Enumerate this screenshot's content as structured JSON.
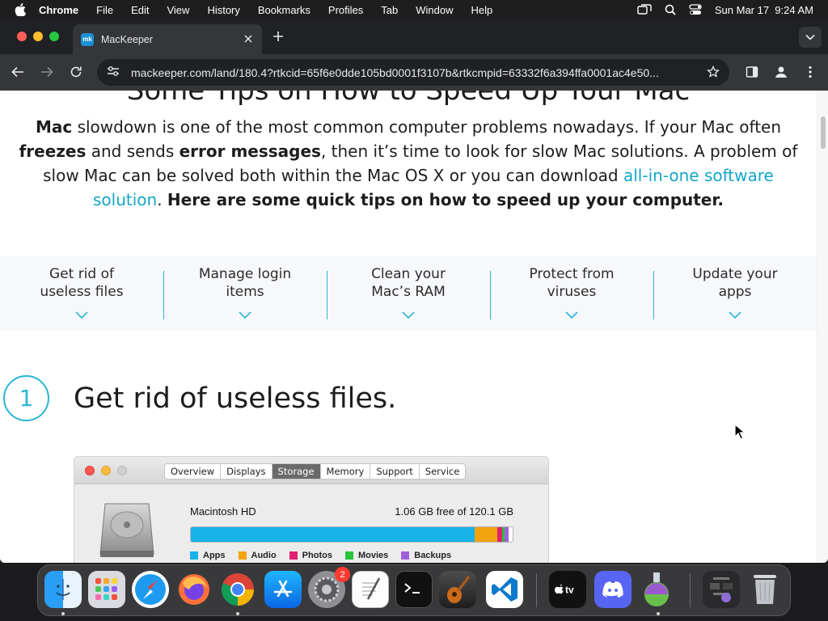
{
  "menubar": {
    "app_name": "Chrome",
    "items": [
      "File",
      "Edit",
      "View",
      "History",
      "Bookmarks",
      "Profiles",
      "Tab",
      "Window",
      "Help"
    ],
    "clock": "Sun Mar 17  9:24 AM"
  },
  "browser": {
    "tab_title": "MacKeeper",
    "favicon_text": "mk",
    "url_host": "mackeeper.com",
    "url_path": "/land/180.4?rtkcid=65f6e0dde105bd0001f3107b&rtkcmpid=63332f6a394ffa0001ac4e50..."
  },
  "page": {
    "heading_partial": "Some Tips on How to Speed Up Your Mac",
    "intro": {
      "p1_bold": "Mac",
      "p1": " slowdown is one of the most common computer problems nowadays. If your Mac often ",
      "p2_bold": "freezes",
      "p2": " and sends ",
      "p3_bold": "error messages",
      "p3": ", then it’s time to look for slow Mac solutions. A problem of slow Mac can be solved both within the Mac OS X or you can download ",
      "link": "all-in-one software solution",
      "p4": ". ",
      "p5_bold": "Here are some quick tips on how to speed up your computer."
    },
    "tips": [
      {
        "line1": "Get rid of",
        "line2": "useless files"
      },
      {
        "line1": "Manage login",
        "line2": "items"
      },
      {
        "line1": "Clean your",
        "line2": "Mac’s RAM"
      },
      {
        "line1": "Protect from",
        "line2": "viruses"
      },
      {
        "line1": "Update your",
        "line2": "apps"
      }
    ],
    "step": {
      "number": "1",
      "title": "Get rid of useless files."
    },
    "about_window": {
      "tabs": [
        "Overview",
        "Displays",
        "Storage",
        "Memory",
        "Support",
        "Service"
      ],
      "active_tab": "Storage",
      "disk_name": "Macintosh HD",
      "free_text": "1.06 GB free of 120.1 GB",
      "legend": [
        {
          "label": "Apps",
          "color": "#17b2e8"
        },
        {
          "label": "Audio",
          "color": "#f2a40f"
        },
        {
          "label": "Photos",
          "color": "#e2206f"
        },
        {
          "label": "Movies",
          "color": "#28c43a"
        },
        {
          "label": "Backups",
          "color": "#a260d8"
        }
      ]
    }
  },
  "dock": {
    "badge_count": "2",
    "apps": [
      "Finder",
      "Launchpad",
      "Safari",
      "Firefox",
      "Chrome",
      "App Store",
      "System Settings",
      "TextEdit",
      "Terminal",
      "GarageBand",
      "Visual Studio Code",
      "Apple TV",
      "Discord",
      "Potion",
      "Downloads",
      "Trash"
    ]
  },
  "colors": {
    "accent": "#2ab6d4",
    "link": "#13a7c9"
  }
}
